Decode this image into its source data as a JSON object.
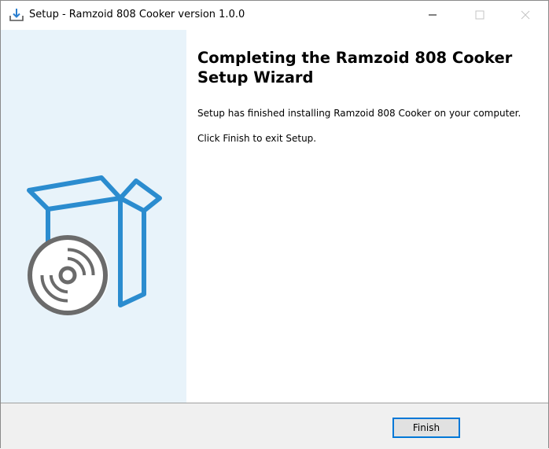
{
  "window": {
    "title": "Setup - Ramzoid 808 Cooker version 1.0.0",
    "icon": "setup-download-icon"
  },
  "titlebar_buttons": {
    "minimize_icon": "minimize-icon",
    "maximize_icon": "maximize-icon",
    "close_icon": "close-icon"
  },
  "sidebar": {
    "illustration": "box-with-disc-icon",
    "colors": {
      "background": "#e8f3fa",
      "box": "#2b8ccf",
      "disc": "#6b6b6b"
    }
  },
  "main": {
    "heading": "Completing the Ramzoid 808 Cooker Setup Wizard",
    "message": "Setup has finished installing Ramzoid 808 Cooker on your computer.",
    "instruction": "Click Finish to exit Setup."
  },
  "footer": {
    "finish_label": "Finish",
    "accent": "#0078d7"
  }
}
